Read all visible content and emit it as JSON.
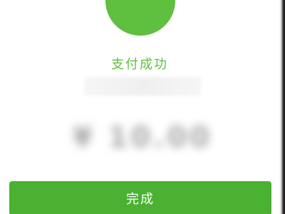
{
  "payment": {
    "status_text": "支付成功",
    "amount_text": "¥ 10.00",
    "done_label": "完成"
  },
  "icons": {
    "success": "checkmark-icon"
  },
  "colors": {
    "accent": "#5fbf3f",
    "button": "#4ab132",
    "button_text": "#ffffff"
  }
}
